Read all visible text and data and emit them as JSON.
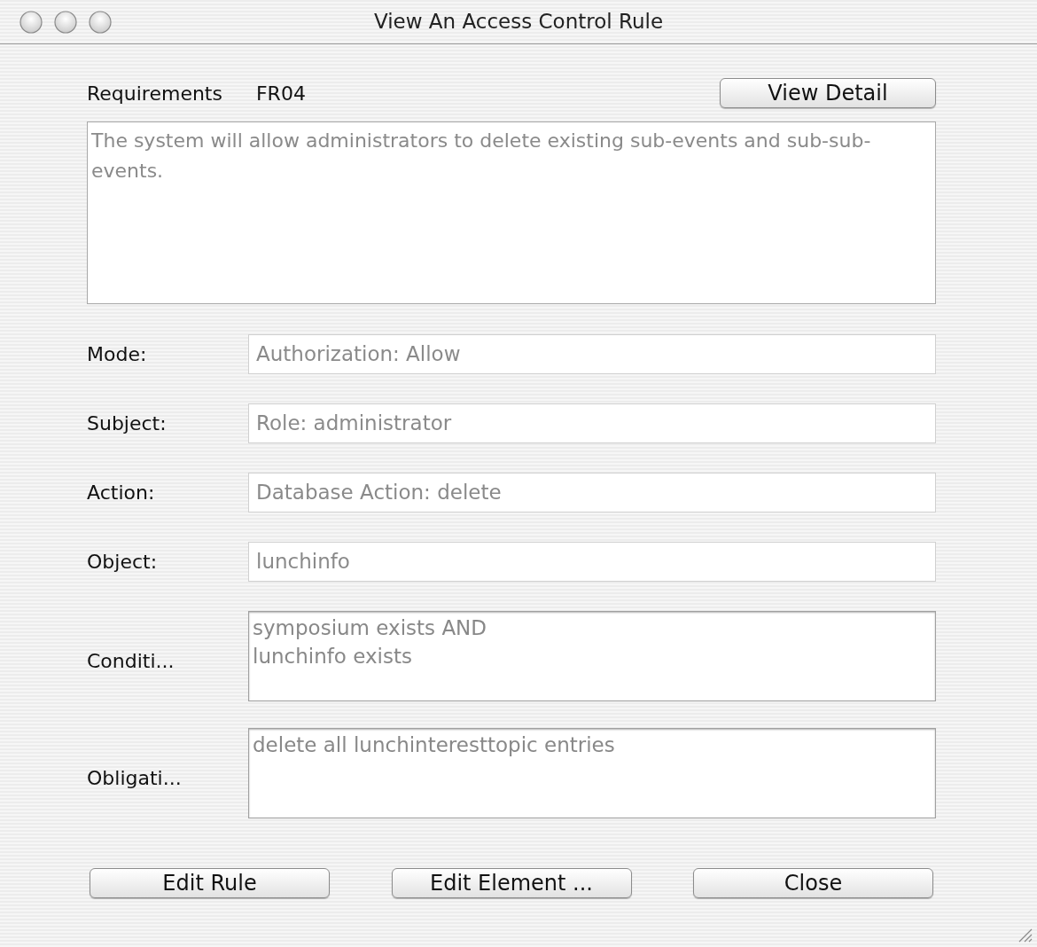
{
  "window": {
    "title": "View An Access Control Rule"
  },
  "requirement": {
    "label": "Requirements",
    "id": "FR04",
    "detail_button": "View Detail",
    "description": "The system will allow administrators to delete existing sub-events and sub-sub-events."
  },
  "fields": [
    {
      "label": "Mode:",
      "kind": "line",
      "value": "Authorization: Allow"
    },
    {
      "label": "Subject:",
      "kind": "line",
      "value": "Role: administrator"
    },
    {
      "label": "Action:",
      "kind": "line",
      "value": "Database Action: delete"
    },
    {
      "label": "Object:",
      "kind": "line",
      "value": "lunchinfo"
    },
    {
      "label": "Conditi...",
      "kind": "area",
      "value": "symposium exists AND\nlunchinfo exists"
    },
    {
      "label": "Obligati...",
      "kind": "area",
      "value": "delete all lunchinteresttopic entries"
    }
  ],
  "buttons": [
    "Edit Rule",
    "Edit Element ...",
    "Close"
  ]
}
